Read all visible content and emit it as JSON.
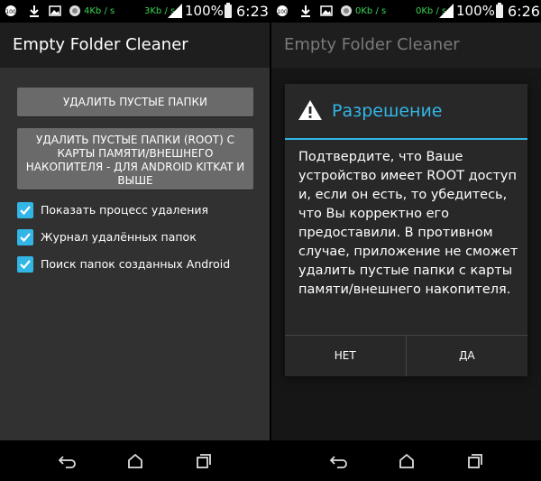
{
  "left_screen": {
    "status_bar": {
      "net_down": "4Kb / s",
      "net_up": "3Kb / s",
      "battery": "100%",
      "time": "6:23",
      "icons": [
        "notification-badge-icon",
        "download-icon",
        "image-icon",
        "app-icon",
        "wifi-icon",
        "signal-icon",
        "battery-icon"
      ]
    },
    "app_title": "Empty Folder Cleaner",
    "buttons": {
      "delete_empty": "УДАЛИТЬ ПУСТЫЕ ПАПКИ",
      "delete_root": "УДАЛИТЬ ПУСТЫЕ ПАПКИ (ROOT) С КАРТЫ ПАМЯТИ/ВНЕШНЕГО НАКОПИТЕЛЯ - ДЛЯ ANDROID KITKAT И ВЫШЕ"
    },
    "checkboxes": [
      {
        "label": "Показать процесс удаления",
        "checked": true
      },
      {
        "label": "Журнал удалённых папок",
        "checked": true
      },
      {
        "label": "Поиск папок созданных Android",
        "checked": true
      }
    ]
  },
  "right_screen": {
    "status_bar": {
      "net_down": "0Kb / s",
      "net_up": "0Kb / s",
      "battery": "100%",
      "time": "6:26"
    },
    "app_title": "Empty Folder Cleaner",
    "dialog": {
      "title": "Разрешение",
      "icon": "warning-icon",
      "message": "Подтвердите, что Ваше устройство имеет ROOT доступ и, если он есть, то убедитесь, что Вы корректно его предоставили. В противном случае, приложение не сможет удалить пустые папки с карты памяти/внешнего накопителя.",
      "no_label": "НЕТ",
      "yes_label": "ДА"
    }
  },
  "nav_icons": [
    "back-icon",
    "home-icon",
    "recents-icon"
  ],
  "colors": {
    "accent": "#33b5e5",
    "status_green": "#39d353",
    "background": "#303030",
    "button": "#6a6a6a"
  }
}
